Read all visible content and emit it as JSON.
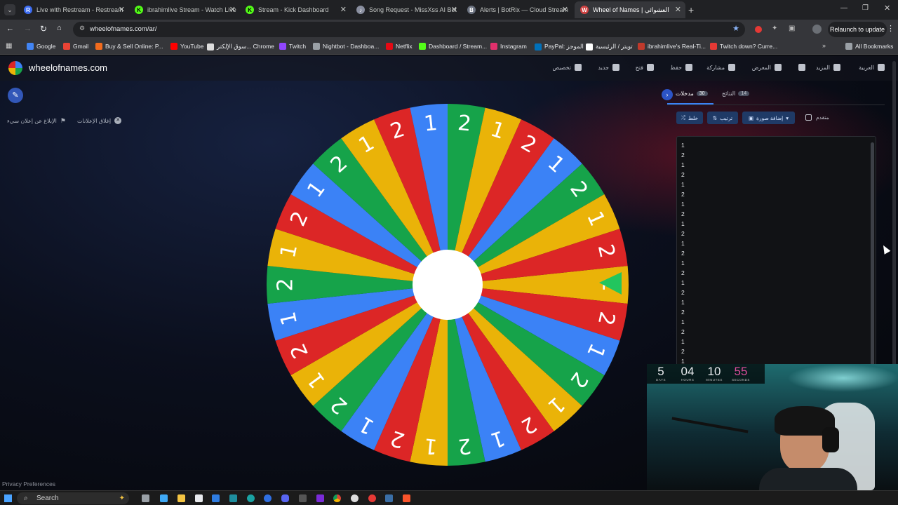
{
  "tabs": [
    {
      "title": "Live with Restream - Restream",
      "icon_color": "#3d6df2",
      "icon_letter": "R"
    },
    {
      "title": "ibrahimlive Stream - Watch Live",
      "icon_color": "#53fc18",
      "icon_letter": "K"
    },
    {
      "title": "Stream - Kick Dashboard",
      "icon_color": "#53fc18",
      "icon_letter": "K"
    },
    {
      "title": "Song Request - MissXss AI Bot",
      "icon_color": "#8a8fa0",
      "icon_letter": "♪"
    },
    {
      "title": "Alerts | BotRix — Cloud Stream",
      "icon_color": "#6b7280",
      "icon_letter": "B"
    },
    {
      "title": "Wheel of Names | العشوائي",
      "icon_color": "#d04242",
      "icon_letter": "W"
    }
  ],
  "toolbar": {
    "url": "wheelofnames.com/ar/",
    "relaunch_label": "Relaunch to update"
  },
  "bookmarks": [
    {
      "label": "Google",
      "color": "#4285f4"
    },
    {
      "label": "Gmail",
      "color": "#ea4335"
    },
    {
      "label": "Buy & Sell Online: P...",
      "color": "#f26b1d"
    },
    {
      "label": "YouTube",
      "color": "#ff0000"
    },
    {
      "label": "سوق الإلكتر... Chrome",
      "color": "#dddddd"
    },
    {
      "label": "Twitch",
      "color": "#9146ff"
    },
    {
      "label": "Nightbot - Dashboa...",
      "color": "#9aa0a6"
    },
    {
      "label": "Netflix",
      "color": "#e50914"
    },
    {
      "label": "Dashboard / Stream...",
      "color": "#53fc18"
    },
    {
      "label": "Instagram",
      "color": "#e1306c"
    },
    {
      "label": "PayPal: الموجز",
      "color": "#0070ba"
    },
    {
      "label": "تويتر / الرئيسية",
      "color": "#ffffff"
    },
    {
      "label": "ibrahimlive's Real-Ti...",
      "color": "#c0392b"
    },
    {
      "label": "Twitch down? Curre...",
      "color": "#e53935"
    }
  ],
  "all_bookmarks_label": "All Bookmarks",
  "site": {
    "name": "wheelofnames.com",
    "nav": [
      {
        "label": "تخصيص",
        "icon": "palette-icon"
      },
      {
        "label": "جديد",
        "icon": "new-file-icon"
      },
      {
        "label": "فتح",
        "icon": "folder-open-icon"
      },
      {
        "label": "حفظ",
        "icon": "save-icon"
      },
      {
        "label": "مشاركة",
        "icon": "share-icon"
      },
      {
        "label": "المعرض",
        "icon": "search-icon"
      },
      {
        "label": "",
        "icon": "fullscreen-icon"
      },
      {
        "label": "المزيد",
        "icon": "chevron-down-icon"
      },
      {
        "label": "العربية",
        "icon": "globe-icon"
      }
    ],
    "close_ads_label": "إغلاق الإعلانات",
    "report_ad_label": "الإبلاغ عن إعلان سيء",
    "privacy_label": "Privacy Preferences"
  },
  "wheel": {
    "segments": [
      "1",
      "2",
      "1",
      "2",
      "1",
      "2",
      "1",
      "2",
      "1",
      "2",
      "1",
      "2",
      "1",
      "2",
      "1",
      "2",
      "1",
      "2",
      "1",
      "2",
      "1",
      "2",
      "1",
      "2",
      "1",
      "2",
      "1",
      "2",
      "1",
      "2"
    ],
    "colors": [
      "#eab308",
      "#dc2626",
      "#3b82f6",
      "#16a34a"
    ]
  },
  "sidebar": {
    "entries_tab_label": "مدخلات",
    "entries_count": "30",
    "results_tab_label": "النتائج",
    "results_count": "14",
    "shuffle_label": "خلط",
    "sort_label": "ترتيب",
    "add_image_label": "إضافة صورة",
    "advanced_label": "متقدم",
    "entries": [
      "1",
      "2",
      "1",
      "2",
      "1",
      "2",
      "1",
      "2",
      "1",
      "2",
      "1",
      "2",
      "1",
      "2",
      "1",
      "2",
      "1",
      "2",
      "1",
      "2",
      "1",
      "2",
      "1"
    ]
  },
  "countdown": [
    {
      "num": "5",
      "label": "DAYS"
    },
    {
      "num": "04",
      "label": "HOURS"
    },
    {
      "num": "10",
      "label": "MINUTES"
    },
    {
      "num": "55",
      "label": "SECONDS"
    }
  ],
  "taskbar": {
    "search_placeholder": "Search"
  }
}
